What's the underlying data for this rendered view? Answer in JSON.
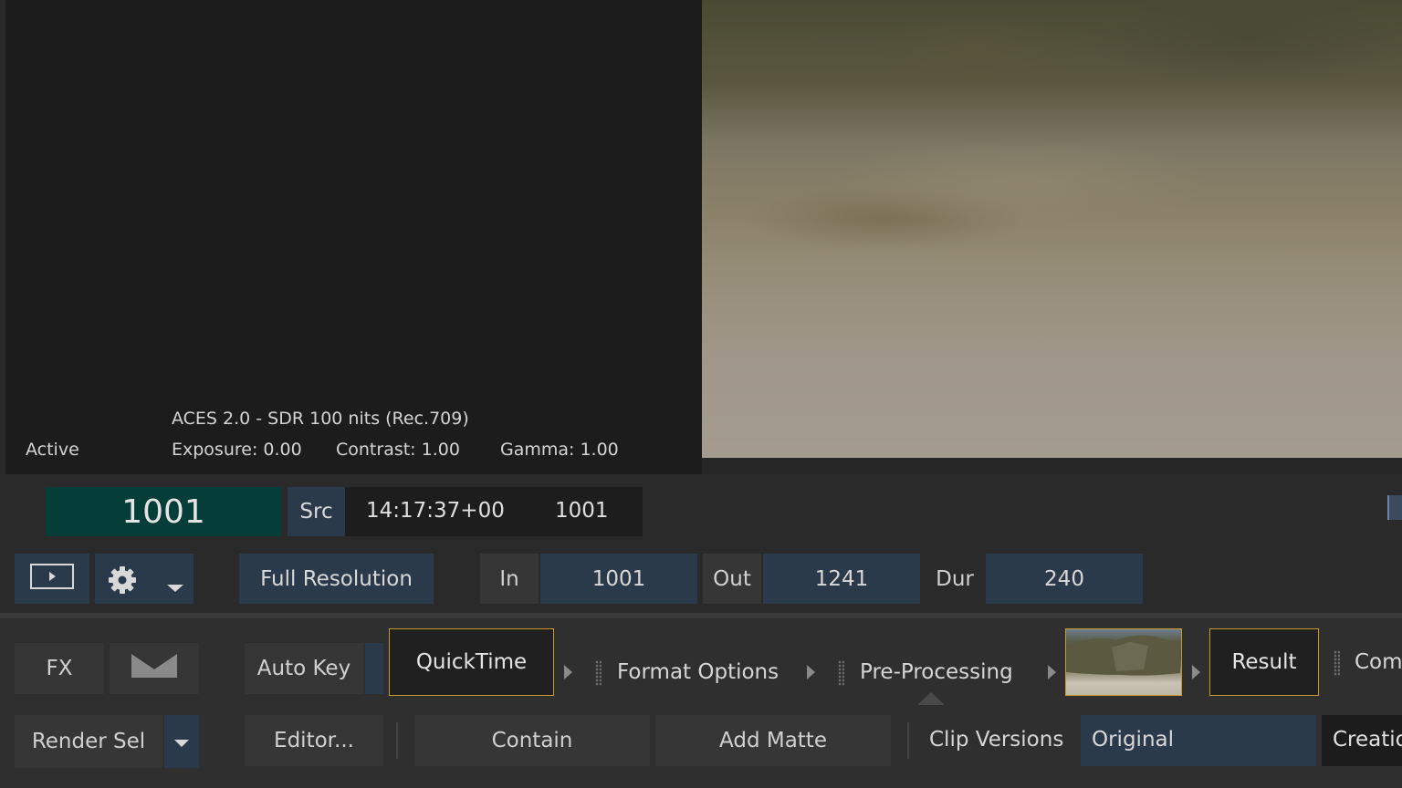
{
  "viewer": {
    "colorspace": "ACES 2.0 - SDR 100 nits (Rec.709)",
    "status": "Active",
    "exposure": "Exposure: 0.00",
    "contrast": "Contrast: 1.00",
    "gamma": "Gamma: 1.00"
  },
  "timecode": {
    "frame": "1001",
    "src_label": "Src",
    "timecode": "14:17:37+00",
    "src_frame": "1001"
  },
  "transport": {
    "play_icon": "play-icon",
    "settings_icon": "gear-icon",
    "dropdown_icon": "chevron-down-icon",
    "resolution": "Full Resolution",
    "in_label": "In",
    "in_value": "1001",
    "out_label": "Out",
    "out_value": "1241",
    "dur_label": "Dur",
    "dur_value": "240"
  },
  "pipeline": {
    "fx_label": "FX",
    "matte_icon": "bowtie-icon",
    "auto_key": "Auto Key",
    "nodes": [
      "QuickTime",
      "Format Options",
      "Pre-Processing",
      "Result",
      "Comp"
    ],
    "render_sel": "Render Sel",
    "editor": "Editor...",
    "contain": "Contain",
    "add_matte": "Add Matte",
    "clip_versions": "Clip Versions",
    "version_value": "Original",
    "creation": "Creatio"
  },
  "colors": {
    "accent_highlight": "#c79a2c",
    "frame_bg": "#053d38",
    "blue_button": "#2b3a4b"
  }
}
